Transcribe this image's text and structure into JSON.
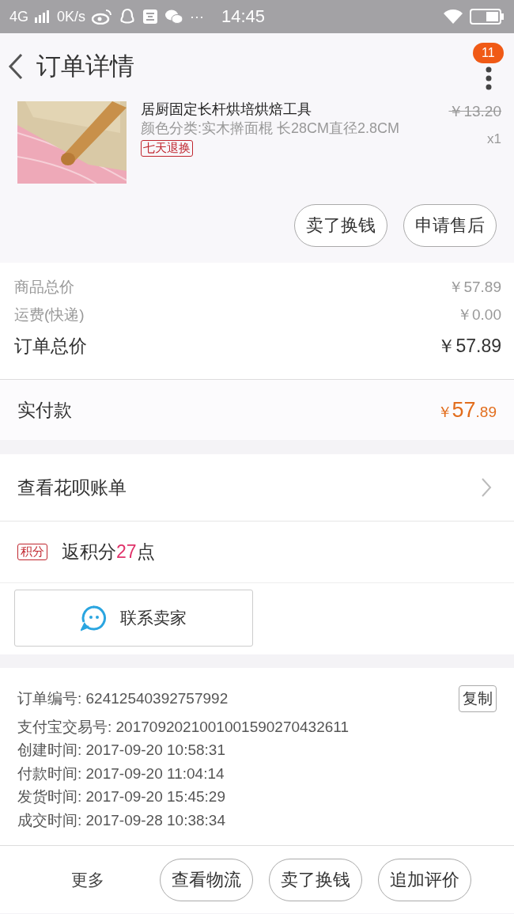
{
  "status_bar": {
    "network": "4G",
    "speed": "0K/s",
    "more": "···",
    "time": "14:45"
  },
  "header": {
    "title": "订单详情",
    "badge": "11"
  },
  "product": {
    "kind": "picture",
    "title": "居厨固定长杆烘培烘焙工具",
    "spec": "颜色分类:实木擀面棍 长28CM直径2.8CM",
    "tag": "七天退换",
    "original_price": "￥13.20",
    "quantity": "x1",
    "actions": [
      "卖了换钱",
      "申请售后"
    ]
  },
  "summary": [
    {
      "kind": "sub",
      "label": "商品总价",
      "value": "￥57.89"
    },
    {
      "kind": "sub",
      "label": "运费(快递)",
      "value": "￥0.00"
    },
    {
      "kind": "total",
      "label": "订单总价",
      "value": "￥57.89"
    }
  ],
  "paid": {
    "label": "实付款",
    "currency": "￥",
    "integer": "57",
    "decimal": ".89"
  },
  "huabei": {
    "label": "查看花呗账单"
  },
  "points": {
    "tag": "积分",
    "prefix": "返积分",
    "number": "27",
    "suffix": "点"
  },
  "contact": {
    "label": "联系卖家"
  },
  "order_info": {
    "copy_button": "复制",
    "lines": [
      {
        "label": "订单编号:",
        "value": "62412540392757992"
      },
      {
        "label": "支付宝交易号:",
        "value": "2017092021001001590270432611"
      },
      {
        "label": "创建时间:",
        "value": "2017-09-20 10:58:31"
      },
      {
        "label": "付款时间:",
        "value": "2017-09-20 11:04:14"
      },
      {
        "label": "发货时间:",
        "value": "2017-09-20 15:45:29"
      },
      {
        "label": "成交时间:",
        "value": "2017-09-28 10:38:34"
      }
    ]
  },
  "bottom_bar": {
    "more": "更多",
    "buttons": [
      "查看物流",
      "卖了换钱",
      "追加评价"
    ]
  }
}
